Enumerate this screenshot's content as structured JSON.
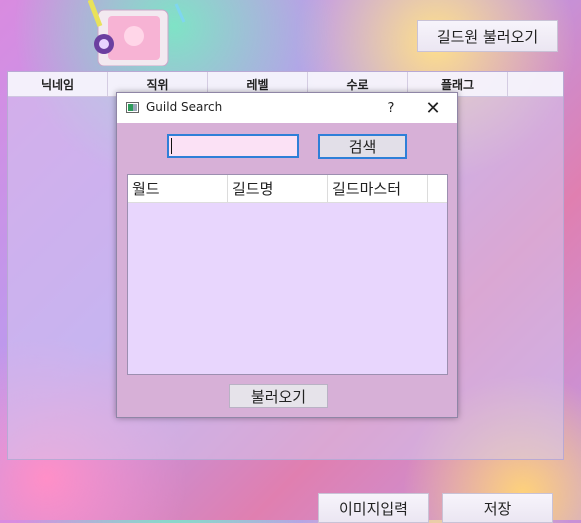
{
  "top_bar": {
    "load_members_label": "길드원 불러오기"
  },
  "member_table": {
    "columns": [
      "닉네임",
      "직위",
      "레벨",
      "수로",
      "플래그"
    ]
  },
  "dialog": {
    "title": "Guild Search",
    "help_label": "?",
    "close_label": "✕",
    "search": {
      "value": "",
      "button_label": "검색"
    },
    "result_table": {
      "columns": [
        "월드",
        "길드명",
        "길드마스터"
      ],
      "rows": []
    },
    "load_button_label": "불러오기"
  },
  "bottom_bar": {
    "image_input_label": "이미지입력",
    "save_label": "저장"
  },
  "colors": {
    "dialog_bg": "#d7b0d7",
    "focus_blue": "#2e7fd8",
    "result_bg": "#e8d6fd"
  }
}
